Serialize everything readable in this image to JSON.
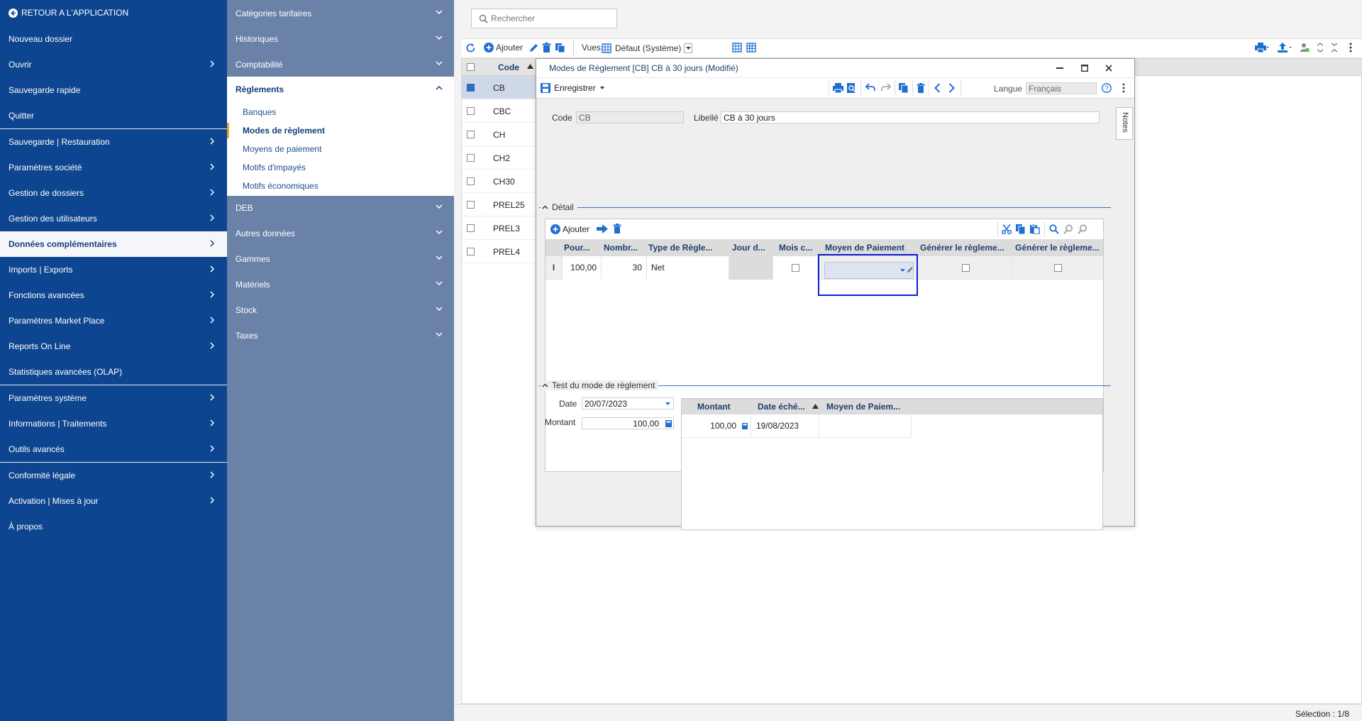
{
  "left_nav": {
    "back_label": "RETOUR A L'APPLICATION",
    "items": [
      {
        "label": "Nouveau dossier"
      },
      {
        "label": "Ouvrir"
      },
      {
        "label": "Sauvegarde rapide"
      },
      {
        "label": "Quitter"
      },
      {
        "label": "Sauvegarde | Restauration"
      },
      {
        "label": "Paramètres société"
      },
      {
        "label": "Gestion de dossiers"
      },
      {
        "label": "Gestion des utilisateurs"
      },
      {
        "label": "Données complémentaires"
      },
      {
        "label": "Imports | Exports"
      },
      {
        "label": "Fonctions avancées"
      },
      {
        "label": "Paramètres Market Place"
      },
      {
        "label": "Reports On Line"
      },
      {
        "label": "Statistiques avancées (OLAP)"
      },
      {
        "label": "Paramètres système"
      },
      {
        "label": "Informations | Traitements"
      },
      {
        "label": "Outils avancés"
      },
      {
        "label": "Conformité légale"
      },
      {
        "label": "Activation | Mises à jour"
      },
      {
        "label": "À propos"
      }
    ]
  },
  "sub_nav": {
    "top_items": [
      {
        "label": "Catégories tarifaires"
      },
      {
        "label": "Historiques"
      },
      {
        "label": "Comptabilité"
      }
    ],
    "open_group": {
      "label": "Règlements",
      "links": [
        {
          "label": "Banques"
        },
        {
          "label": "Modes de règlement"
        },
        {
          "label": "Moyens de paiement"
        },
        {
          "label": "Motifs d'impayés"
        },
        {
          "label": "Motifs économiques"
        }
      ]
    },
    "bottom_items": [
      {
        "label": "DEB"
      },
      {
        "label": "Autres données"
      },
      {
        "label": "Gammes"
      },
      {
        "label": "Matériels"
      },
      {
        "label": "Stock"
      },
      {
        "label": "Taxes"
      }
    ]
  },
  "main": {
    "search_placeholder": "Rechercher",
    "toolbar": {
      "add_label": "Ajouter",
      "views_label": "Vues",
      "view_value": "Défaut (Système)"
    },
    "list": {
      "col_code": "Code",
      "rows": [
        {
          "code": "CB",
          "selected": true
        },
        {
          "code": "CBC"
        },
        {
          "code": "CH"
        },
        {
          "code": "CH2"
        },
        {
          "code": "CH30"
        },
        {
          "code": "PREL25"
        },
        {
          "code": "PREL3"
        },
        {
          "code": "PREL4"
        }
      ]
    },
    "status": "Sélection : 1/8"
  },
  "dialog": {
    "title": "Modes de Règlement [CB] CB à 30 jours (Modifié)",
    "save_label": "Enregistrer",
    "language_label": "Langue",
    "language_value": "Français",
    "notes_tab": "Notes",
    "code_label": "Code",
    "code_value": "CB",
    "libelle_label": "Libellé",
    "libelle_value": "CB à 30 jours",
    "detail": {
      "section_title": "Détail",
      "add_label": "Ajouter",
      "columns": [
        "Pour...",
        "Nombr...",
        "Type de Règle...",
        "Jour d...",
        "Mois c...",
        "Moyen de Paiement",
        "Générer le règleme...",
        "Générer le règleme..."
      ],
      "row": {
        "marker": "I",
        "pourcentage": "100,00",
        "nombre": "30",
        "type": "Net",
        "jour": "",
        "moyen": ""
      }
    },
    "test": {
      "section_title": "Test du mode de règlement",
      "date_label": "Date",
      "date_value": "20/07/2023",
      "montant_label": "Montant",
      "montant_value": "100,00",
      "columns": [
        "Montant",
        "Date éché...",
        "Moyen de Paiem..."
      ],
      "rows": [
        {
          "montant": "100,00",
          "date": "19/08/2023",
          "moyen": ""
        }
      ]
    }
  }
}
